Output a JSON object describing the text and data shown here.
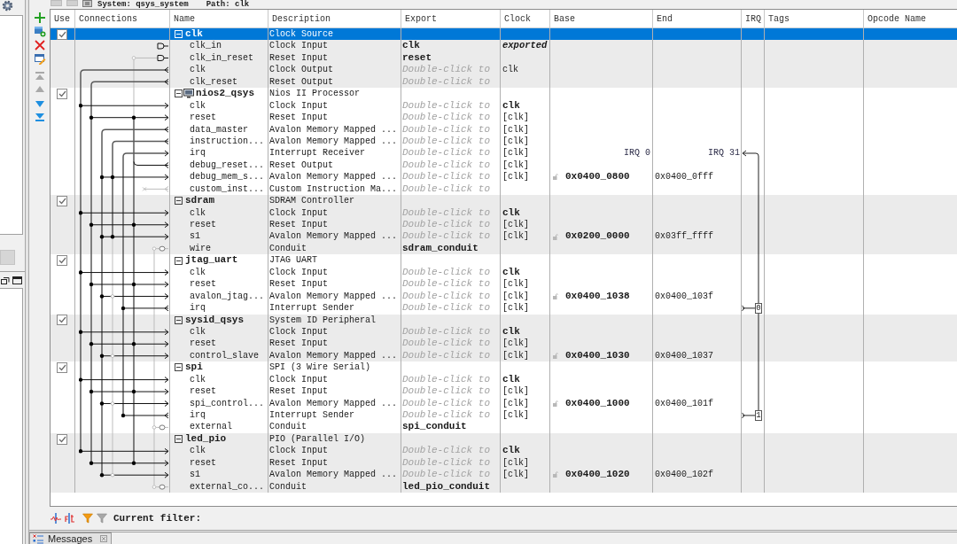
{
  "top_bar": {
    "system": "System: qsys_system",
    "path": "Path: clk"
  },
  "toolbar": [
    {
      "kind": "add",
      "disabled": false
    },
    {
      "kind": "add_component",
      "disabled": false
    },
    {
      "kind": "remove",
      "disabled": false
    },
    {
      "kind": "edit",
      "disabled": false
    },
    {
      "kind": "move_top",
      "disabled": true
    },
    {
      "kind": "move_up",
      "disabled": true
    },
    {
      "kind": "move_down",
      "disabled": false
    },
    {
      "kind": "move_bottom",
      "disabled": false
    }
  ],
  "table": {
    "columns": [
      "Use",
      "Connections",
      "Name",
      "Description",
      "Export",
      "Clock",
      "Base",
      "End",
      "IRQ",
      "Tags",
      "Opcode Name"
    ],
    "modules": [
      {
        "name": "clk",
        "description": "Clock Source",
        "kind": "component",
        "use": true,
        "selected": true,
        "expanded": true,
        "interfaces": [
          {
            "name": "clk_in",
            "description": "Clock Input",
            "export": {
              "value": "clk"
            },
            "clock": {
              "text": "exported",
              "kind": "exported"
            },
            "selected": false
          },
          {
            "name": "clk_in_reset",
            "description": "Reset Input",
            "export": {
              "value": "reset"
            },
            "selected": false
          },
          {
            "name": "clk",
            "description": "Clock Output",
            "export": {
              "placeholder": "Double-click to"
            },
            "clock": {
              "text": "clk",
              "kind": "output"
            },
            "selected": false
          },
          {
            "name": "clk_reset",
            "description": "Reset Output",
            "export": {
              "placeholder": "Double-click to"
            },
            "selected": false
          }
        ]
      },
      {
        "name": "nios2_qsys",
        "description": "Nios II Processor",
        "kind": "processor",
        "use": true,
        "selected": false,
        "expanded": true,
        "interfaces": [
          {
            "name": "clk",
            "description": "Clock Input",
            "export": {
              "placeholder": "Double-click to"
            },
            "clock": {
              "text": "clk",
              "kind": "explicit"
            },
            "selected": false
          },
          {
            "name": "reset",
            "description": "Reset Input",
            "export": {
              "placeholder": "Double-click to"
            },
            "clock": {
              "text": "[clk]",
              "kind": "inferred"
            },
            "selected": false
          },
          {
            "name": "data_master",
            "description": "Avalon Memory Mapped ...",
            "export": {
              "placeholder": "Double-click to"
            },
            "clock": {
              "text": "[clk]",
              "kind": "inferred"
            },
            "selected": false
          },
          {
            "name": "instruction...",
            "description": "Avalon Memory Mapped ...",
            "export": {
              "placeholder": "Double-click to"
            },
            "clock": {
              "text": "[clk]",
              "kind": "inferred"
            },
            "selected": false
          },
          {
            "name": "irq",
            "description": "Interrupt Receiver",
            "export": {
              "placeholder": "Double-click to"
            },
            "clock": {
              "text": "[clk]",
              "kind": "inferred"
            },
            "irq_range": {
              "low": "IRQ 0",
              "high": "IRQ 31"
            },
            "selected": false
          },
          {
            "name": "debug_reset...",
            "description": "Reset Output",
            "export": {
              "placeholder": "Double-click to"
            },
            "clock": {
              "text": "[clk]",
              "kind": "inferred"
            },
            "selected": false
          },
          {
            "name": "debug_mem_s...",
            "description": "Avalon Memory Mapped ...",
            "export": {
              "placeholder": "Double-click to"
            },
            "clock": {
              "text": "[clk]",
              "kind": "inferred"
            },
            "base": "0x0400_0800",
            "end": "0x0400_0fff",
            "selected": false
          },
          {
            "name": "custom_inst...",
            "description": "Custom Instruction Ma...",
            "export": {
              "placeholder": "Double-click to"
            },
            "selected": false
          }
        ]
      },
      {
        "name": "sdram",
        "description": "SDRAM Controller",
        "kind": "component",
        "use": true,
        "selected": false,
        "expanded": true,
        "interfaces": [
          {
            "name": "clk",
            "description": "Clock Input",
            "export": {
              "placeholder": "Double-click to"
            },
            "clock": {
              "text": "clk",
              "kind": "explicit"
            },
            "selected": false
          },
          {
            "name": "reset",
            "description": "Reset Input",
            "export": {
              "placeholder": "Double-click to"
            },
            "clock": {
              "text": "[clk]",
              "kind": "inferred"
            },
            "selected": false
          },
          {
            "name": "s1",
            "description": "Avalon Memory Mapped ...",
            "export": {
              "placeholder": "Double-click to"
            },
            "clock": {
              "text": "[clk]",
              "kind": "inferred"
            },
            "base": "0x0200_0000",
            "end": "0x03ff_ffff",
            "selected": false
          },
          {
            "name": "wire",
            "description": "Conduit",
            "export": {
              "value": "sdram_conduit"
            },
            "selected": false
          }
        ]
      },
      {
        "name": "jtag_uart",
        "description": "JTAG UART",
        "kind": "component",
        "use": true,
        "selected": false,
        "expanded": true,
        "interfaces": [
          {
            "name": "clk",
            "description": "Clock Input",
            "export": {
              "placeholder": "Double-click to"
            },
            "clock": {
              "text": "clk",
              "kind": "explicit"
            },
            "selected": false
          },
          {
            "name": "reset",
            "description": "Reset Input",
            "export": {
              "placeholder": "Double-click to"
            },
            "clock": {
              "text": "[clk]",
              "kind": "inferred"
            },
            "selected": false
          },
          {
            "name": "avalon_jtag...",
            "description": "Avalon Memory Mapped ...",
            "export": {
              "placeholder": "Double-click to"
            },
            "clock": {
              "text": "[clk]",
              "kind": "inferred"
            },
            "base": "0x0400_1038",
            "end": "0x0400_103f",
            "selected": false
          },
          {
            "name": "irq",
            "description": "Interrupt Sender",
            "export": {
              "placeholder": "Double-click to"
            },
            "clock": {
              "text": "[clk]",
              "kind": "inferred"
            },
            "irq": "0",
            "selected": false
          }
        ]
      },
      {
        "name": "sysid_qsys",
        "description": "System ID Peripheral",
        "kind": "component",
        "use": true,
        "selected": false,
        "expanded": true,
        "interfaces": [
          {
            "name": "clk",
            "description": "Clock Input",
            "export": {
              "placeholder": "Double-click to"
            },
            "clock": {
              "text": "clk",
              "kind": "explicit"
            },
            "selected": false
          },
          {
            "name": "reset",
            "description": "Reset Input",
            "export": {
              "placeholder": "Double-click to"
            },
            "clock": {
              "text": "[clk]",
              "kind": "inferred"
            },
            "selected": false
          },
          {
            "name": "control_slave",
            "description": "Avalon Memory Mapped ...",
            "export": {
              "placeholder": "Double-click to"
            },
            "clock": {
              "text": "[clk]",
              "kind": "inferred"
            },
            "base": "0x0400_1030",
            "end": "0x0400_1037",
            "selected": false
          }
        ]
      },
      {
        "name": "spi",
        "description": "SPI (3 Wire Serial)",
        "kind": "component",
        "use": true,
        "selected": false,
        "expanded": true,
        "interfaces": [
          {
            "name": "clk",
            "description": "Clock Input",
            "export": {
              "placeholder": "Double-click to"
            },
            "clock": {
              "text": "clk",
              "kind": "explicit"
            },
            "selected": false
          },
          {
            "name": "reset",
            "description": "Reset Input",
            "export": {
              "placeholder": "Double-click to"
            },
            "clock": {
              "text": "[clk]",
              "kind": "inferred"
            },
            "selected": false
          },
          {
            "name": "spi_control...",
            "description": "Avalon Memory Mapped ...",
            "export": {
              "placeholder": "Double-click to"
            },
            "clock": {
              "text": "[clk]",
              "kind": "inferred"
            },
            "base": "0x0400_1000",
            "end": "0x0400_101f",
            "selected": false
          },
          {
            "name": "irq",
            "description": "Interrupt Sender",
            "export": {
              "placeholder": "Double-click to"
            },
            "clock": {
              "text": "[clk]",
              "kind": "inferred"
            },
            "irq": "1",
            "selected": false
          },
          {
            "name": "external",
            "description": "Conduit",
            "export": {
              "value": "spi_conduit"
            },
            "selected": false
          }
        ]
      },
      {
        "name": "led_pio",
        "description": "PIO (Parallel I/O)",
        "kind": "component",
        "use": true,
        "selected": false,
        "expanded": true,
        "interfaces": [
          {
            "name": "clk",
            "description": "Clock Input",
            "export": {
              "placeholder": "Double-click to"
            },
            "clock": {
              "text": "clk",
              "kind": "explicit"
            },
            "selected": false
          },
          {
            "name": "reset",
            "description": "Reset Input",
            "export": {
              "placeholder": "Double-click to"
            },
            "clock": {
              "text": "[clk]",
              "kind": "inferred"
            },
            "selected": false
          },
          {
            "name": "s1",
            "description": "Avalon Memory Mapped ...",
            "export": {
              "placeholder": "Double-click to"
            },
            "clock": {
              "text": "[clk]",
              "kind": "inferred"
            },
            "base": "0x0400_1020",
            "end": "0x0400_102f",
            "selected": false
          },
          {
            "name": "external_co...",
            "description": "Conduit",
            "export": {
              "value": "led_pio_conduit"
            },
            "selected": false
          }
        ]
      }
    ]
  },
  "filter_bar": {
    "label": "Current filter:"
  },
  "bottom_tabs": [
    {
      "label": "Messages"
    }
  ]
}
